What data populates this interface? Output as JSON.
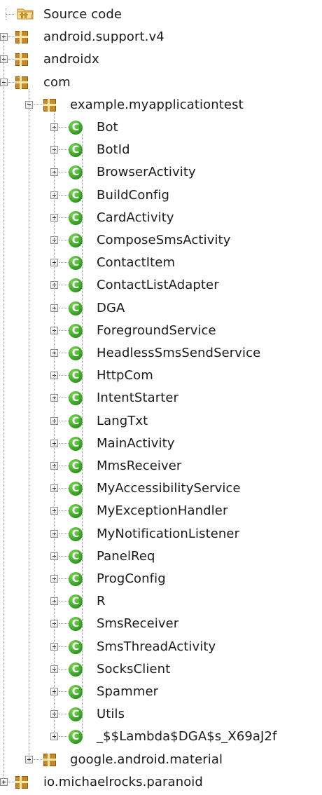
{
  "root": {
    "label": "Source code",
    "icon": "source-folder-icon"
  },
  "packages_top": [
    {
      "label": "android.support.v4",
      "expanded": false
    },
    {
      "label": "androidx",
      "expanded": false
    },
    {
      "label": "com",
      "expanded": true
    }
  ],
  "subpackage": {
    "label": "example.myapplicationtest",
    "expanded": true
  },
  "classes": [
    "Bot",
    "BotId",
    "BrowserActivity",
    "BuildConfig",
    "CardActivity",
    "ComposeSmsActivity",
    "ContactItem",
    "ContactListAdapter",
    "DGA",
    "ForegroundService",
    "HeadlessSmsSendService",
    "HttpCom",
    "IntentStarter",
    "LangTxt",
    "MainActivity",
    "MmsReceiver",
    "MyAccessibilityService",
    "MyExceptionHandler",
    "MyNotificationListener",
    "PanelReq",
    "ProgConfig",
    "R",
    "SmsReceiver",
    "SmsThreadActivity",
    "SocksClient",
    "Spammer",
    "Utils",
    "_$$Lambda$DGA$s_X69aJ2f"
  ],
  "class_icon_glyph": "C",
  "sub_sibling": {
    "label": "google.android.material",
    "expanded": false
  },
  "packages_bottom": [
    {
      "label": "io.michaelrocks.paranoid",
      "expanded": false
    }
  ],
  "colors": {
    "class_icon": "#2e9a1e",
    "package_icon": "#c68a2b"
  }
}
